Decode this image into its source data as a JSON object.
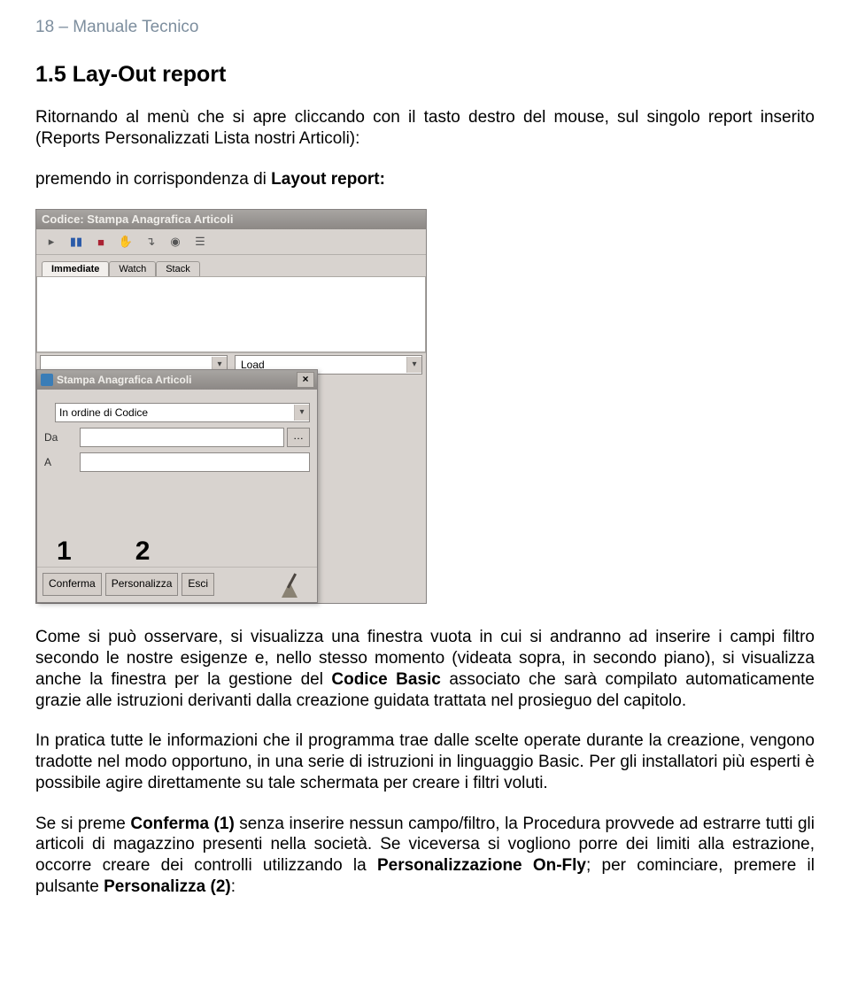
{
  "header": "18 – Manuale Tecnico",
  "section_title": "1.5 Lay-Out report",
  "para1_a": "Ritornando al menù che si apre cliccando con il tasto destro del mouse, sul singolo report inserito (Reports Personalizzati Lista nostri Articoli):",
  "para1_b_pre": "premendo in corrispondenza di ",
  "para1_b_bold": "Layout report:",
  "screenshot": {
    "window_title": "Codice: Stampa Anagrafica Articoli",
    "tabs": {
      "immediate": "Immediate",
      "watch": "Watch",
      "stack": "Stack"
    },
    "right_dd": "Load",
    "dialog": {
      "title": "Stampa Anagrafica Articoli",
      "order_combo": "In ordine di Codice",
      "label_da": "Da",
      "label_a": "A",
      "num1": "1",
      "num2": "2",
      "btn_conferma": "Conferma",
      "btn_personalizza": "Personalizza",
      "btn_esci": "Esci",
      "browse": "…"
    }
  },
  "para2_pre": "Come si può osservare, si visualizza una finestra vuota in cui si andranno ad inserire i campi filtro secondo le nostre esigenze e, nello stesso momento (videata sopra, in secondo piano), si visualizza anche la finestra per la gestione del ",
  "para2_bold": "Codice Basic",
  "para2_post": " associato che sarà compilato automaticamente grazie alle istruzioni derivanti dalla creazione guidata trattata nel prosieguo del capitolo.",
  "para3": "In pratica tutte le informazioni che il programma trae dalle scelte operate durante la creazione, vengono tradotte nel modo opportuno, in una serie di istruzioni in linguaggio Basic. Per gli installatori più esperti è possibile agire direttamente su tale schermata per creare i filtri voluti.",
  "para4_a": "Se si preme ",
  "para4_b": "Conferma (1)",
  "para4_c": " senza inserire nessun campo/filtro, la Procedura provvede ad estrarre tutti gli articoli di magazzino presenti nella società. Se viceversa si vogliono porre dei limiti alla estrazione, occorre creare dei controlli utilizzando la ",
  "para4_d": "Personalizzazione On-Fly",
  "para4_e": "; per cominciare, premere il pulsante ",
  "para4_f": "Personalizza (2)",
  "para4_g": ":"
}
